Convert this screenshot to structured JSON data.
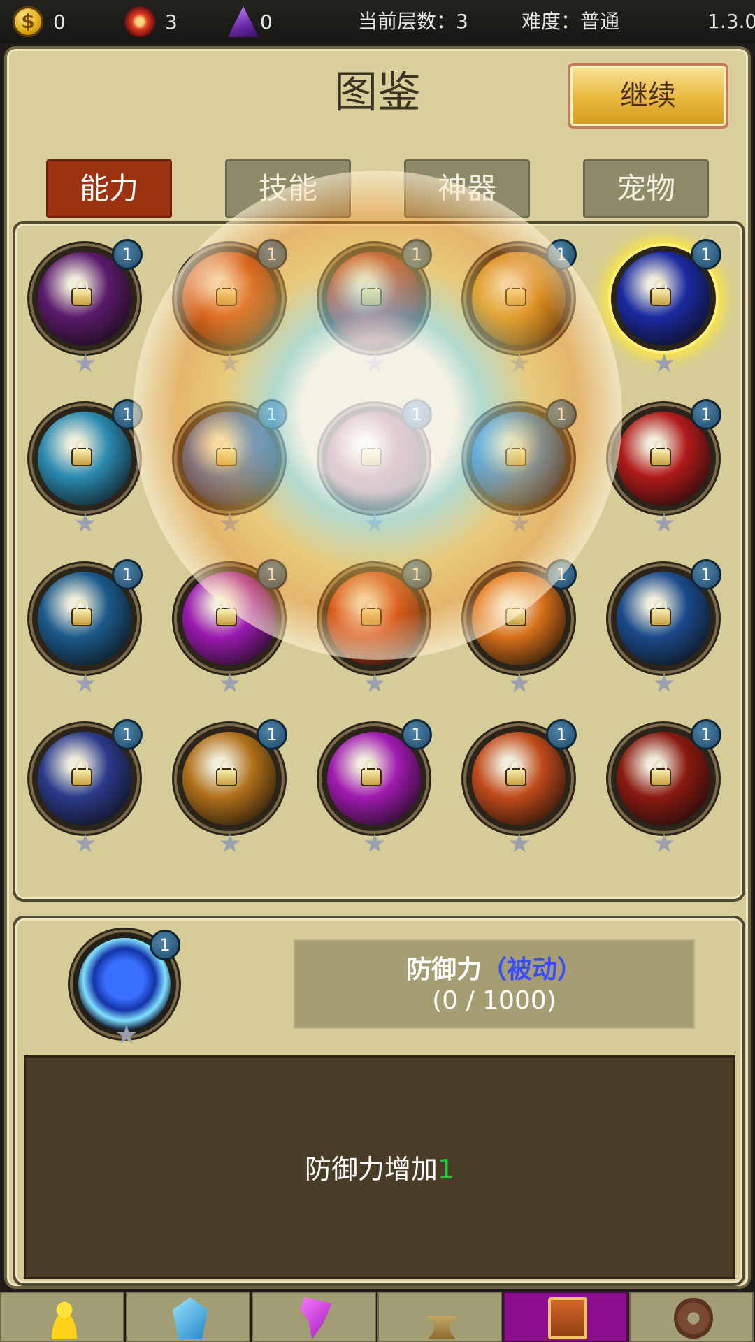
{
  "topbar": {
    "gold": "0",
    "red_gem": "3",
    "purple_gem": "0",
    "floor": "当前层数：3",
    "difficulty": "难度：普通",
    "version": "1.3.0"
  },
  "header": {
    "title": "图鉴",
    "continue_label": "继续"
  },
  "tabs": [
    "能力",
    "技能",
    "神器",
    "宠物"
  ],
  "active_tab": "能力",
  "grid": {
    "items": [
      {
        "icon": "dark-purple-tendril-icon",
        "level": "1",
        "locked": true,
        "color": "#5a1a6a"
      },
      {
        "icon": "fire-swirl-icon",
        "level": "1",
        "locked": true,
        "color": "#c8501a"
      },
      {
        "icon": "red-slash-icon",
        "level": "1",
        "locked": true,
        "color": "#a02a2a"
      },
      {
        "icon": "golden-rune-icon",
        "level": "1",
        "locked": true,
        "color": "#c88a1a"
      },
      {
        "icon": "blue-shield-icon",
        "level": "1",
        "locked": true,
        "color": "#1a2aa0",
        "selected": true
      },
      {
        "icon": "cyan-figure-icon",
        "level": "1",
        "locked": true,
        "color": "#2a8ab0"
      },
      {
        "icon": "blue-orange-swirl-icon",
        "level": "1",
        "locked": true,
        "color": "#3a5aa8"
      },
      {
        "icon": "red-white-swirl-icon",
        "level": "1",
        "locked": true,
        "color": "#8a3a4a"
      },
      {
        "icon": "blue-wave-icon",
        "level": "1",
        "locked": true,
        "color": "#2a6ab8"
      },
      {
        "icon": "blood-drop-icon",
        "level": "1",
        "locked": true,
        "color": "#b01a1a"
      },
      {
        "icon": "ice-claw-icon",
        "level": "1",
        "locked": true,
        "color": "#1a5a8a"
      },
      {
        "icon": "purple-orb-icon",
        "level": "1",
        "locked": true,
        "color": "#9a1ab0"
      },
      {
        "icon": "fire-burst-icon",
        "level": "1",
        "locked": true,
        "color": "#c8401a"
      },
      {
        "icon": "flame-slash-icon",
        "level": "1",
        "locked": true,
        "color": "#d8701a"
      },
      {
        "icon": "ice-spark-icon",
        "level": "1",
        "locked": true,
        "color": "#1a4a8a"
      },
      {
        "icon": "lightning-icon",
        "level": "1",
        "locked": true,
        "color": "#2a3a8a"
      },
      {
        "icon": "meteor-icon",
        "level": "1",
        "locked": true,
        "color": "#b0701a"
      },
      {
        "icon": "shadow-figure-icon",
        "level": "1",
        "locked": true,
        "color": "#a01ab0"
      },
      {
        "icon": "fire-beast-icon",
        "level": "1",
        "locked": true,
        "color": "#c04a1a"
      },
      {
        "icon": "red-dragon-icon",
        "level": "1",
        "locked": true,
        "color": "#8a1a10"
      }
    ]
  },
  "detail": {
    "icon": "blue-shield-icon",
    "level": "1",
    "name": "防御力",
    "type": "（被动）",
    "progress": "(0 / 1000)",
    "description": "防御力增加",
    "value": "1"
  },
  "bottom_nav": [
    {
      "icon": "character-icon",
      "active": false
    },
    {
      "icon": "crystal-icon",
      "active": false
    },
    {
      "icon": "purple-rune-icon",
      "active": false
    },
    {
      "icon": "anvil-hammer-icon",
      "active": false
    },
    {
      "icon": "codex-book-icon",
      "active": true
    },
    {
      "icon": "gear-icon",
      "active": false
    }
  ]
}
